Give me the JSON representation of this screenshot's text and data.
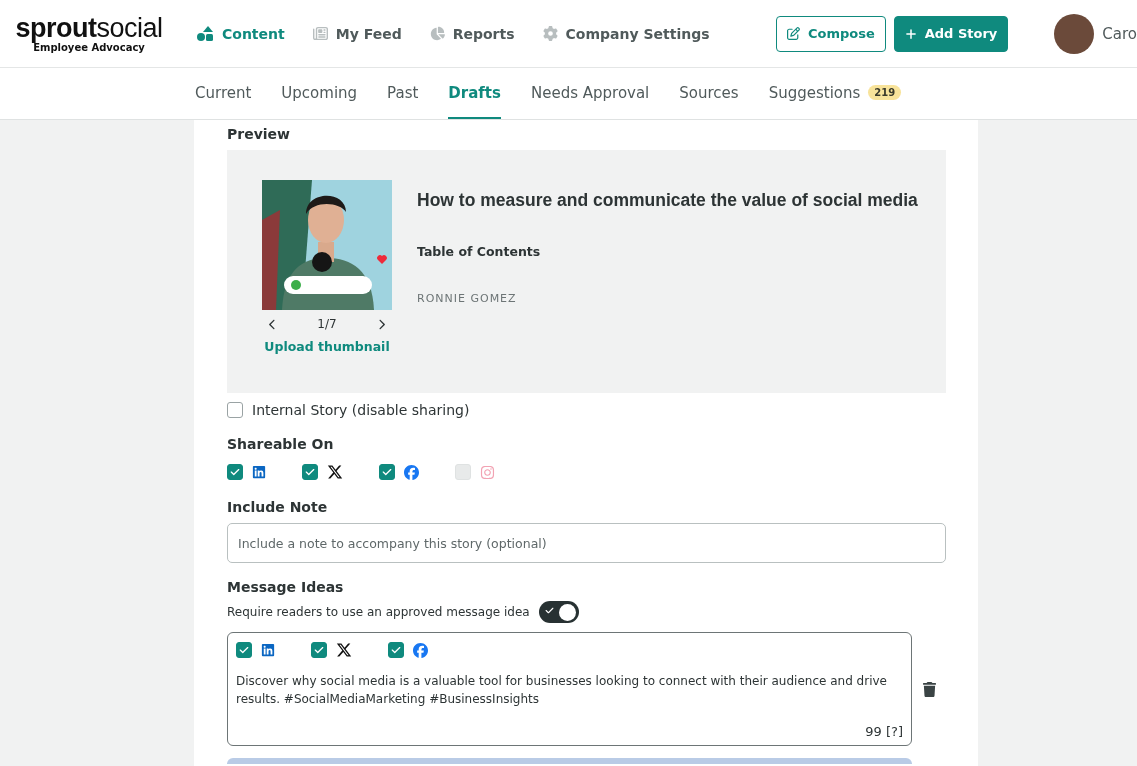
{
  "brand": {
    "logo": "**sprout**social",
    "subtitle": "Employee Advocacy"
  },
  "nav": [
    {
      "label": "Content",
      "kind": "content",
      "selected": true
    },
    {
      "label": "My Feed",
      "kind": "feed",
      "selected": false
    },
    {
      "label": "Reports",
      "kind": "reports",
      "selected": false
    },
    {
      "label": "Company Settings",
      "kind": "settings",
      "selected": false
    }
  ],
  "actions": [
    {
      "label": "Compose",
      "kind": "outline"
    },
    {
      "label": "Add Story",
      "kind": "solid"
    }
  ],
  "user": {
    "name": "Caro"
  },
  "tabs": [
    {
      "label": "Current",
      "selected": false
    },
    {
      "label": "Upcoming",
      "selected": false
    },
    {
      "label": "Past",
      "selected": false
    },
    {
      "label": "Drafts",
      "selected": true
    },
    {
      "label": "Needs Approval",
      "selected": false
    },
    {
      "label": "Sources",
      "selected": false
    },
    {
      "label": "Suggestions",
      "selected": false,
      "badge": "219"
    }
  ],
  "preview": {
    "heading": "Preview",
    "pager": "1/7",
    "upload": "Upload thumbnail",
    "title": "How to measure and communicate the value of social media",
    "subtitle": "Table of Contents",
    "author": "RONNIE GOMEZ"
  },
  "internal_story": {
    "label": "Internal Story (disable sharing)",
    "checked": false
  },
  "shareable": {
    "heading": "Shareable On",
    "networks": [
      {
        "kind": "linkedin",
        "checked": true,
        "disabled": false
      },
      {
        "kind": "x",
        "checked": true,
        "disabled": false
      },
      {
        "kind": "facebook",
        "checked": true,
        "disabled": false
      },
      {
        "kind": "instagram",
        "checked": false,
        "disabled": true
      }
    ]
  },
  "note": {
    "heading": "Include Note",
    "placeholder": "Include a note to accompany this story (optional)"
  },
  "message_ideas": {
    "heading": "Message Ideas",
    "require_label": "Require readers to use an approved message idea",
    "require_on": true,
    "ideas": [
      {
        "networks": [
          {
            "kind": "linkedin",
            "checked": true
          },
          {
            "kind": "x",
            "checked": true
          },
          {
            "kind": "facebook",
            "checked": true
          }
        ],
        "text": "Discover why social media is a valuable tool for businesses looking to connect with their audience and drive results. #SocialMediaMarketing #BusinessInsights",
        "count": "99",
        "help": "[?]"
      }
    ]
  }
}
